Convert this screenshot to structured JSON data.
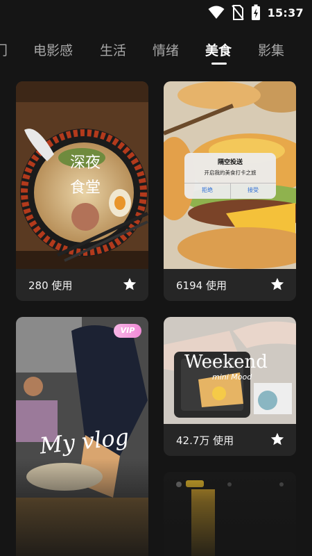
{
  "status_bar": {
    "time": "15:37"
  },
  "tabs": [
    {
      "label": "门"
    },
    {
      "label": "电影感"
    },
    {
      "label": "生活"
    },
    {
      "label": "情绪"
    },
    {
      "label": "美食",
      "active": true
    },
    {
      "label": "影集"
    }
  ],
  "cards": [
    {
      "id": "ramen",
      "overlay_title": "深夜食堂",
      "count": "280 使用"
    },
    {
      "id": "burger",
      "popup_title": "隔空投送",
      "popup_message": "开启我的美食打卡之旅",
      "popup_decline": "拒绝",
      "popup_accept": "接受",
      "count": "6194 使用"
    },
    {
      "id": "vlog",
      "badge": "VIP",
      "overlay_title": "My vlog"
    },
    {
      "id": "weekend",
      "overlay_title": "Weekend",
      "overlay_subtitle": "mini Mood",
      "count": "42.7万 使用"
    }
  ],
  "colors": {
    "background": "#151515",
    "card": "#262626",
    "active_tab": "#ffffff",
    "inactive_tab": "#a8a8a8"
  }
}
